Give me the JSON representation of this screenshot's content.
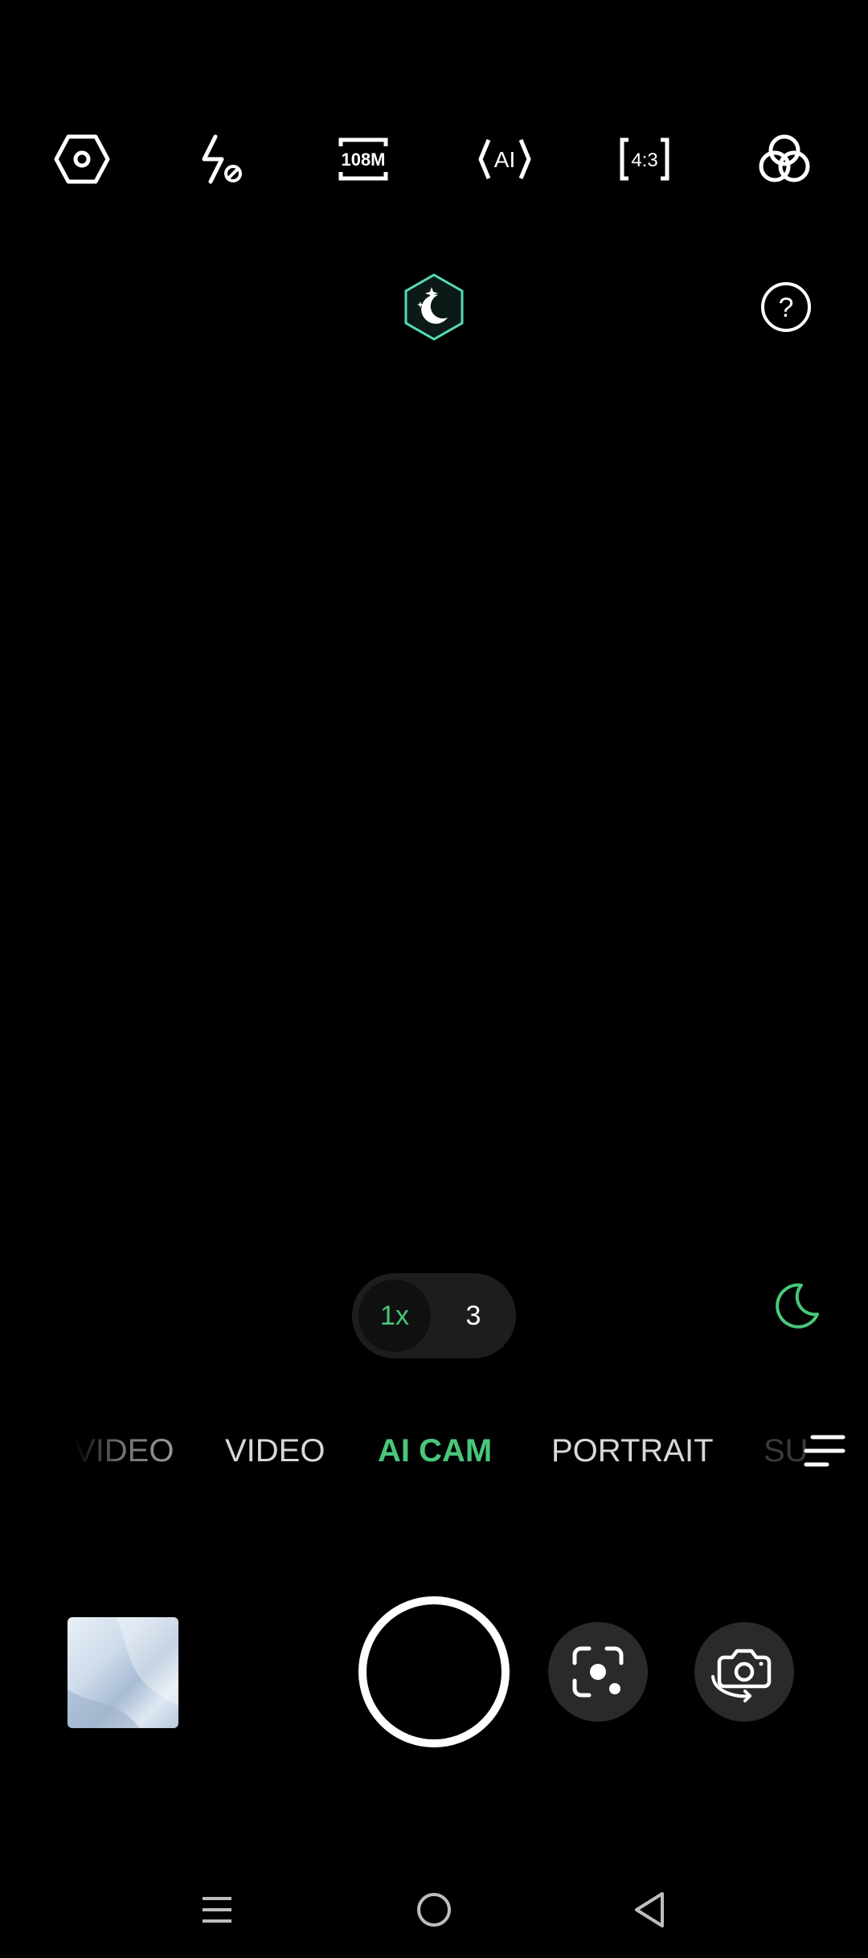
{
  "colors": {
    "accent": "#3ddc84",
    "accent_green": "#48c77a",
    "background": "#000000",
    "icon": "#ffffff"
  },
  "top_toolbar": {
    "items": [
      {
        "icon": "settings-hexagon-icon"
      },
      {
        "icon": "flash-off-icon"
      },
      {
        "icon": "resolution-108m-icon",
        "label": "108M"
      },
      {
        "icon": "ai-scene-icon",
        "label": "AI"
      },
      {
        "icon": "aspect-ratio-icon",
        "label": "4:3"
      },
      {
        "icon": "filters-icon"
      }
    ]
  },
  "second_row": {
    "night_mode_badge": {
      "icon": "night-mode-hexagon-icon"
    },
    "help": {
      "icon": "help-icon",
      "label": "?"
    }
  },
  "zoom": {
    "options": [
      "1x",
      "3"
    ],
    "selected": "1x"
  },
  "night_indicator": {
    "icon": "moon-icon"
  },
  "modes": {
    "items": [
      "VIDEO",
      "VIDEO",
      "AI CAM",
      "PORTRAIT",
      "SU"
    ],
    "selected": "AI CAM",
    "more_icon": "menu-lines-icon"
  },
  "bottom_controls": {
    "gallery_thumbnail": "gallery-thumbnail",
    "shutter": "shutter-button",
    "lens_button": "google-lens-icon",
    "switch_camera": "switch-camera-icon"
  },
  "nav_bar": {
    "items": [
      "recent-apps-icon",
      "home-icon",
      "back-icon"
    ]
  }
}
